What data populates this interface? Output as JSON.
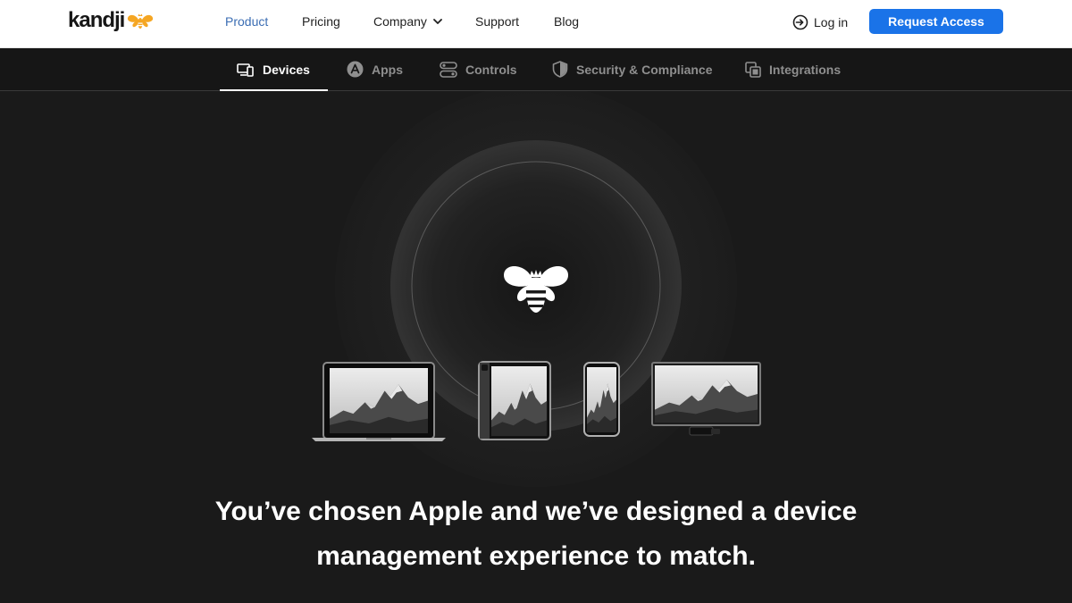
{
  "brand": {
    "name": "kandji",
    "icon": "bee-logo-icon",
    "accent": "#f5a623"
  },
  "nav": {
    "items": [
      {
        "label": "Product",
        "active": true
      },
      {
        "label": "Pricing"
      },
      {
        "label": "Company",
        "has_dropdown": true
      },
      {
        "label": "Support"
      },
      {
        "label": "Blog"
      }
    ],
    "login_label": "Log in",
    "cta_label": "Request Access",
    "cta_color": "#1a73e8",
    "active_color": "#3b6db3"
  },
  "tabs": [
    {
      "label": "Devices",
      "icon": "devices-icon",
      "active": true
    },
    {
      "label": "Apps",
      "icon": "app-store-icon"
    },
    {
      "label": "Controls",
      "icon": "controls-icon"
    },
    {
      "label": "Security & Compliance",
      "icon": "shield-icon"
    },
    {
      "label": "Integrations",
      "icon": "integrations-icon"
    }
  ],
  "hero": {
    "headline_line1": "You’ve chosen Apple and we’ve designed a device",
    "headline_line2": "management experience to match.",
    "center_icon": "bee-icon",
    "devices": [
      "laptop",
      "tablet",
      "phone",
      "tv"
    ]
  }
}
